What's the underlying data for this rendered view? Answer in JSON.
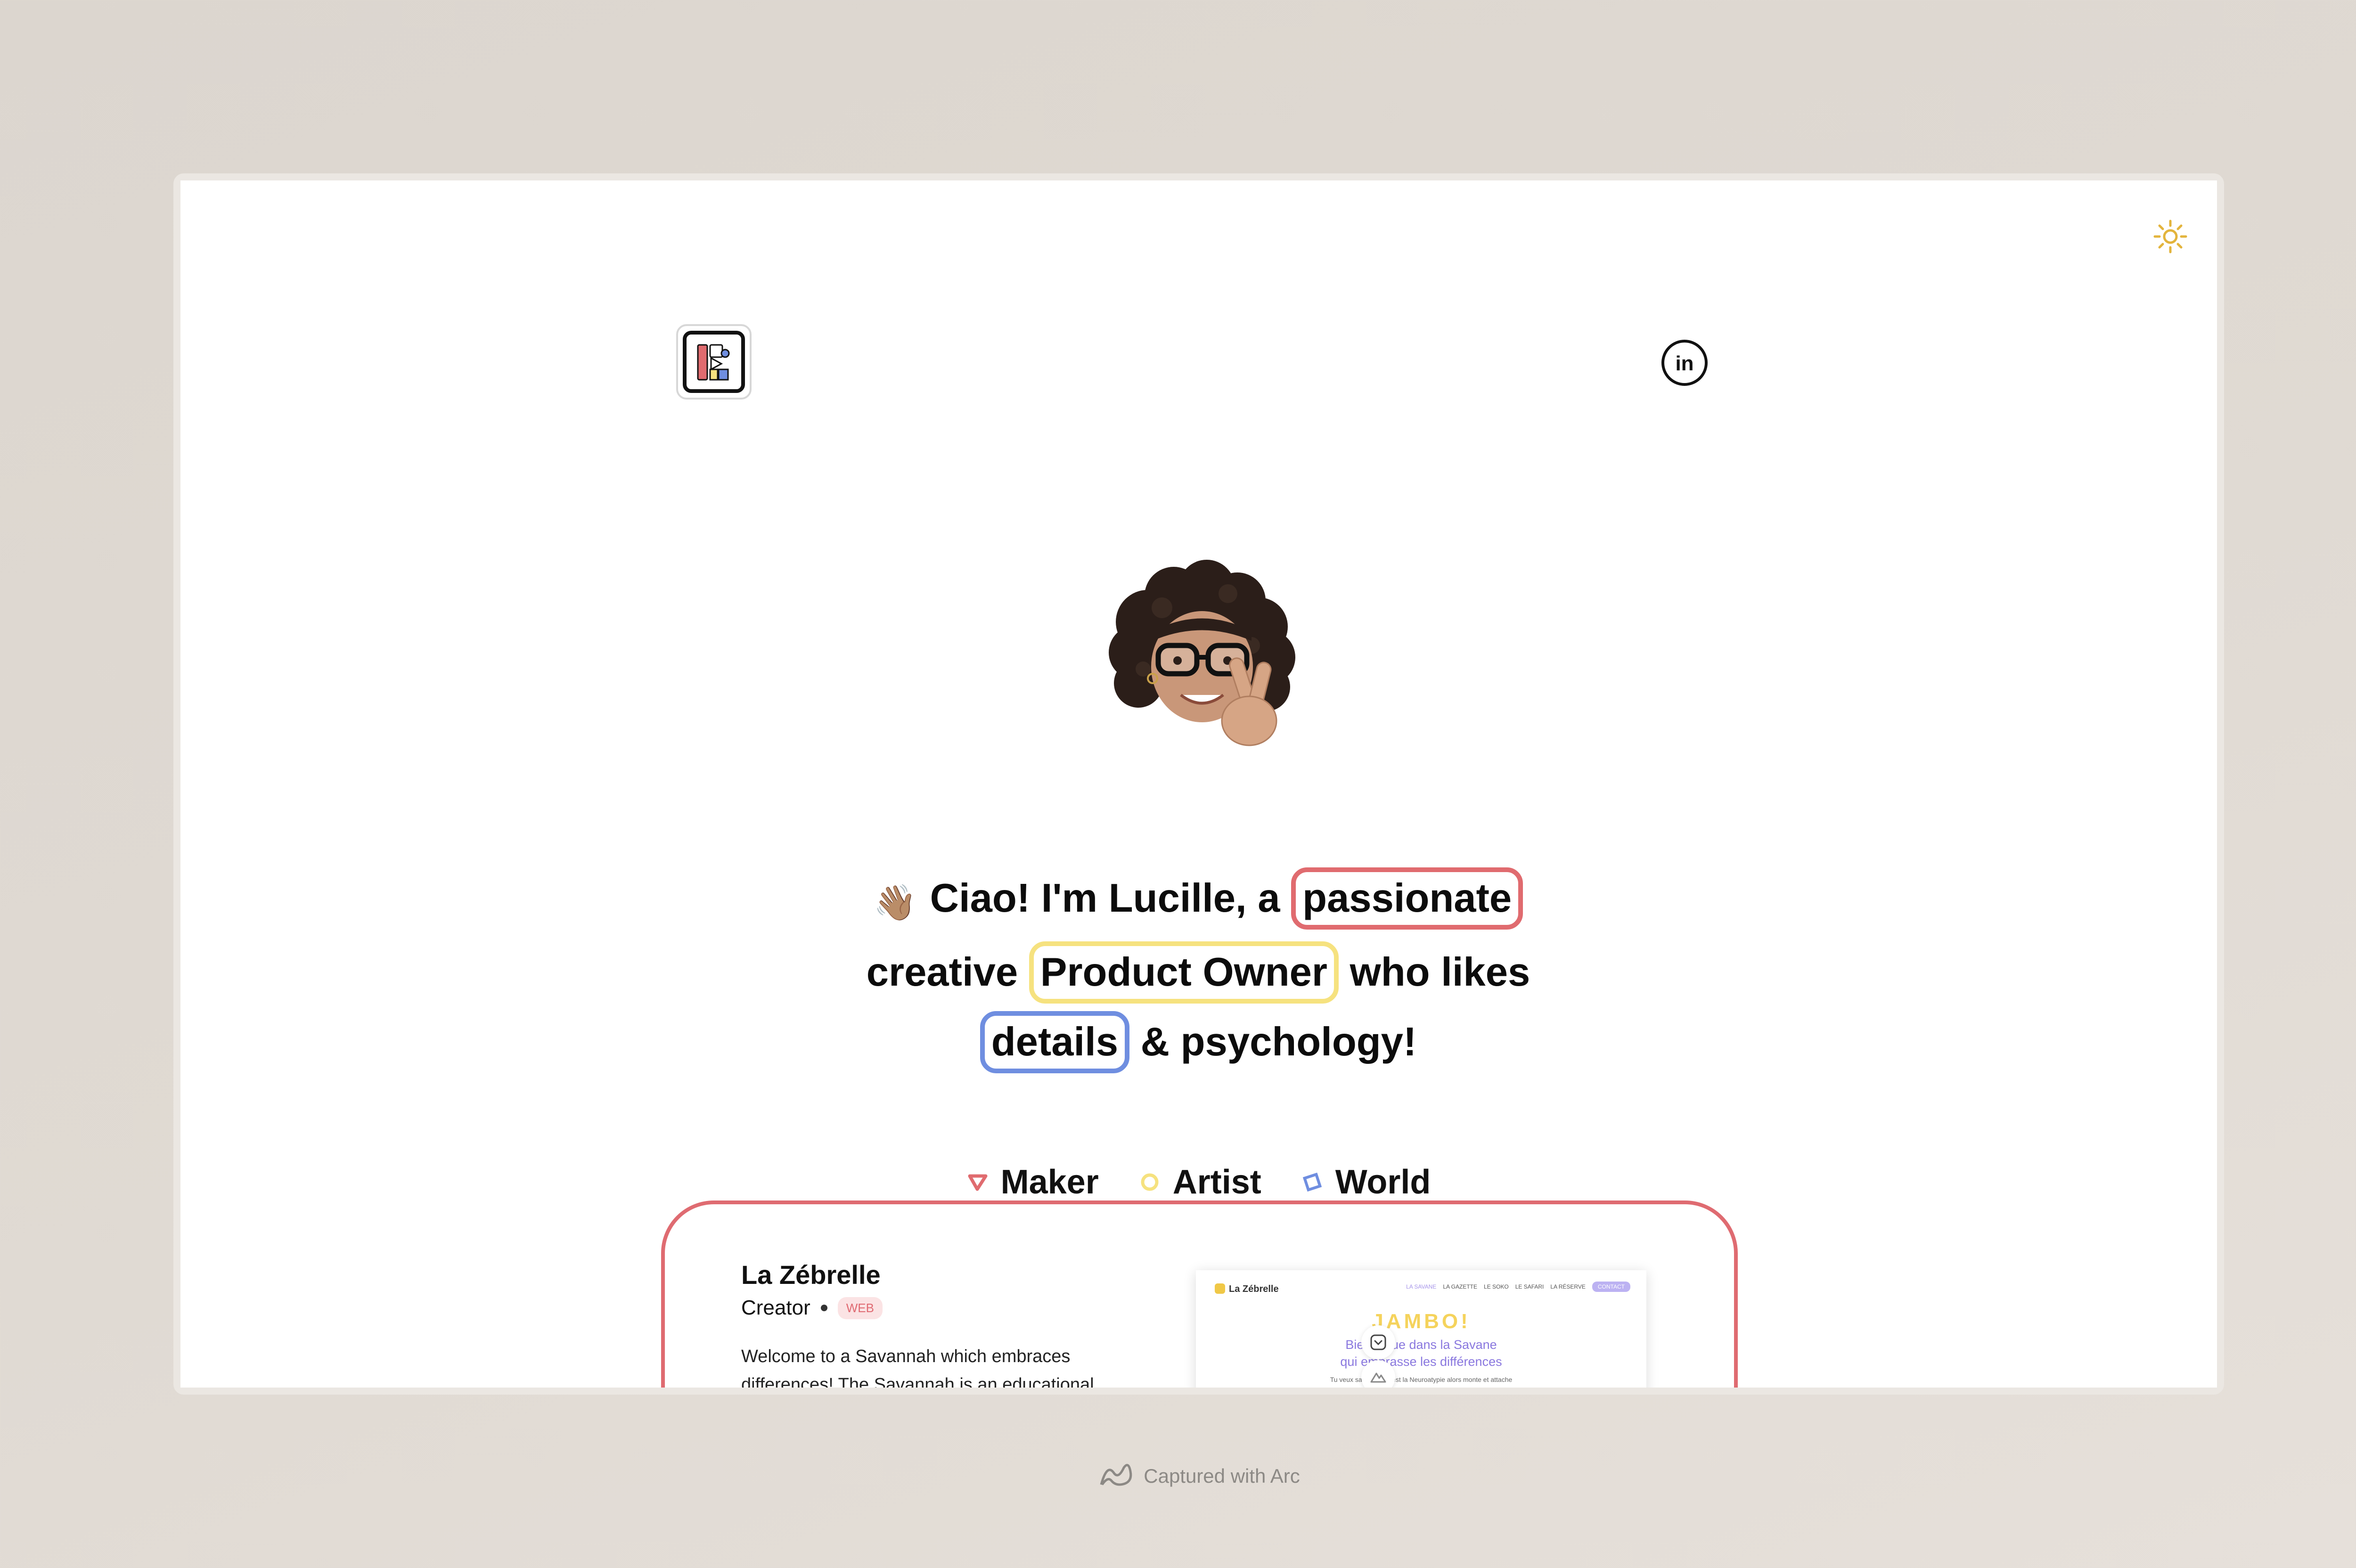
{
  "headline": {
    "wave_emoji": "👋🏽",
    "part1": "Ciao! I'm Lucille, a",
    "highlight1": "passionate",
    "part2": "creative",
    "highlight2": "Product Owner",
    "part3": "who likes",
    "highlight3": "details",
    "part4": "& psychology!"
  },
  "tabs": [
    {
      "label": "Maker",
      "icon": "triangle-icon",
      "color": "#e06b6f",
      "active": true
    },
    {
      "label": "Artist",
      "icon": "circle-icon",
      "color": "#f6e27f",
      "active": false
    },
    {
      "label": "World",
      "icon": "square-icon",
      "color": "#6f8ee0",
      "active": false
    }
  ],
  "project": {
    "title": "La Zébrelle",
    "role": "Creator",
    "badge": "WEB",
    "description": "Welcome to a Savannah which embraces differences! The Savannah is an educational",
    "preview": {
      "brand": "La Zébrelle",
      "nav": [
        "LA SAVANE",
        "LA GAZETTE",
        "LE SOKO",
        "LE SAFARI",
        "LA RÉSERVE",
        "CONTACT"
      ],
      "heading": "JAMBO!",
      "subtitle_line1": "Bienvenue dans la Savane",
      "subtitle_line2": "qui embrasse les différences",
      "small_text": "Tu veux savoir ce qu'est la Neuroatypie alors monte et attache"
    }
  },
  "footer": {
    "text": "Captured with Arc",
    "icon": "arc-icon"
  },
  "icons": {
    "theme": "sun-icon",
    "logo": "logo-icon",
    "social": "linkedin-icon",
    "avatar": "memoji-avatar"
  },
  "colors": {
    "red": "#e06b6f",
    "yellow": "#f6e27f",
    "blue": "#6f8ee0",
    "sun": "#e3b43c",
    "badge_bg": "#fbe3e4",
    "badge_text": "#e06a72"
  }
}
